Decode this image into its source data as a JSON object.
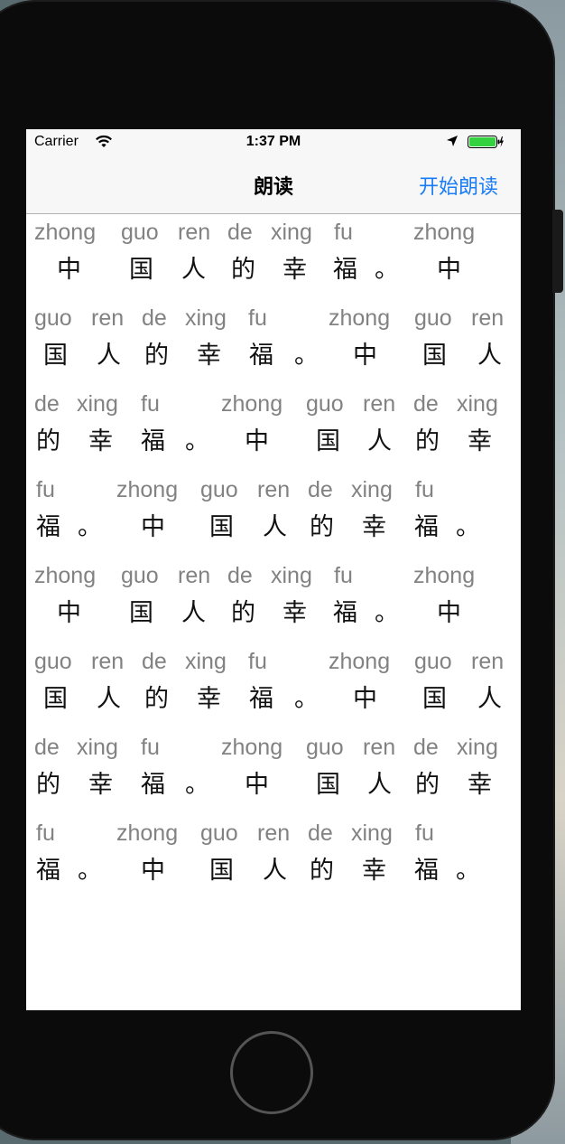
{
  "status_bar": {
    "carrier": "Carrier",
    "time": "1:37 PM"
  },
  "nav": {
    "title": "朗读",
    "action_label": "开始朗读"
  },
  "lines": [
    {
      "pinyin": [
        "zhong",
        "guo",
        "ren",
        "de",
        "xing",
        "fu",
        "zhong"
      ],
      "hanzi": [
        "中",
        "国",
        "人",
        "的",
        "幸",
        "福",
        "。",
        "中"
      ]
    },
    {
      "pinyin": [
        "guo",
        "ren",
        "de",
        "xing",
        "fu",
        "zhong",
        "guo",
        "ren"
      ],
      "hanzi": [
        "国",
        "人",
        "的",
        "幸",
        "福",
        "。",
        "中",
        "国",
        "人"
      ]
    },
    {
      "pinyin": [
        "de",
        "xing",
        "fu",
        "zhong",
        "guo",
        "ren",
        "de",
        "xing"
      ],
      "hanzi": [
        "的",
        "幸",
        "福",
        "。",
        "中",
        "国",
        "人",
        "的",
        "幸"
      ]
    },
    {
      "pinyin": [
        "fu",
        "zhong",
        "guo",
        "ren",
        "de",
        "xing",
        "fu"
      ],
      "hanzi": [
        "福",
        "。",
        "中",
        "国",
        "人",
        "的",
        "幸",
        "福",
        "。"
      ]
    },
    {
      "pinyin": [
        "zhong",
        "guo",
        "ren",
        "de",
        "xing",
        "fu",
        "zhong"
      ],
      "hanzi": [
        "中",
        "国",
        "人",
        "的",
        "幸",
        "福",
        "。",
        "中"
      ]
    },
    {
      "pinyin": [
        "guo",
        "ren",
        "de",
        "xing",
        "fu",
        "zhong",
        "guo",
        "ren"
      ],
      "hanzi": [
        "国",
        "人",
        "的",
        "幸",
        "福",
        "。",
        "中",
        "国",
        "人"
      ]
    },
    {
      "pinyin": [
        "de",
        "xing",
        "fu",
        "zhong",
        "guo",
        "ren",
        "de",
        "xing"
      ],
      "hanzi": [
        "的",
        "幸",
        "福",
        "。",
        "中",
        "国",
        "人",
        "的",
        "幸"
      ]
    },
    {
      "pinyin": [
        "fu",
        "zhong",
        "guo",
        "ren",
        "de",
        "xing",
        "fu"
      ],
      "hanzi": [
        "福",
        "。",
        "中",
        "国",
        "人",
        "的",
        "幸",
        "福",
        "。"
      ]
    }
  ],
  "colors": {
    "accent": "#1a7cf5",
    "pinyin": "#828282",
    "hanzi": "#111111",
    "battery": "#35d23f"
  }
}
